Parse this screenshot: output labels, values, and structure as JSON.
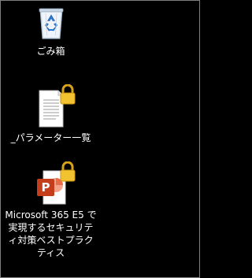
{
  "desktop": {
    "background_color": "#000000",
    "icons": [
      {
        "label": "ごみ箱",
        "icon": "recycle-bin-icon",
        "locked": false
      },
      {
        "label": "_パラメーター一覧",
        "icon": "text-document-icon",
        "locked": true
      },
      {
        "label": "Microsoft 365 E5 で実現するセキュリティ対策ベストプラクティス",
        "icon": "powerpoint-icon",
        "locked": true
      }
    ]
  },
  "colors": {
    "lock_gold": "#f2c230",
    "powerpoint_red": "#c43e1c",
    "recycle_blue": "#2e7bd6"
  }
}
